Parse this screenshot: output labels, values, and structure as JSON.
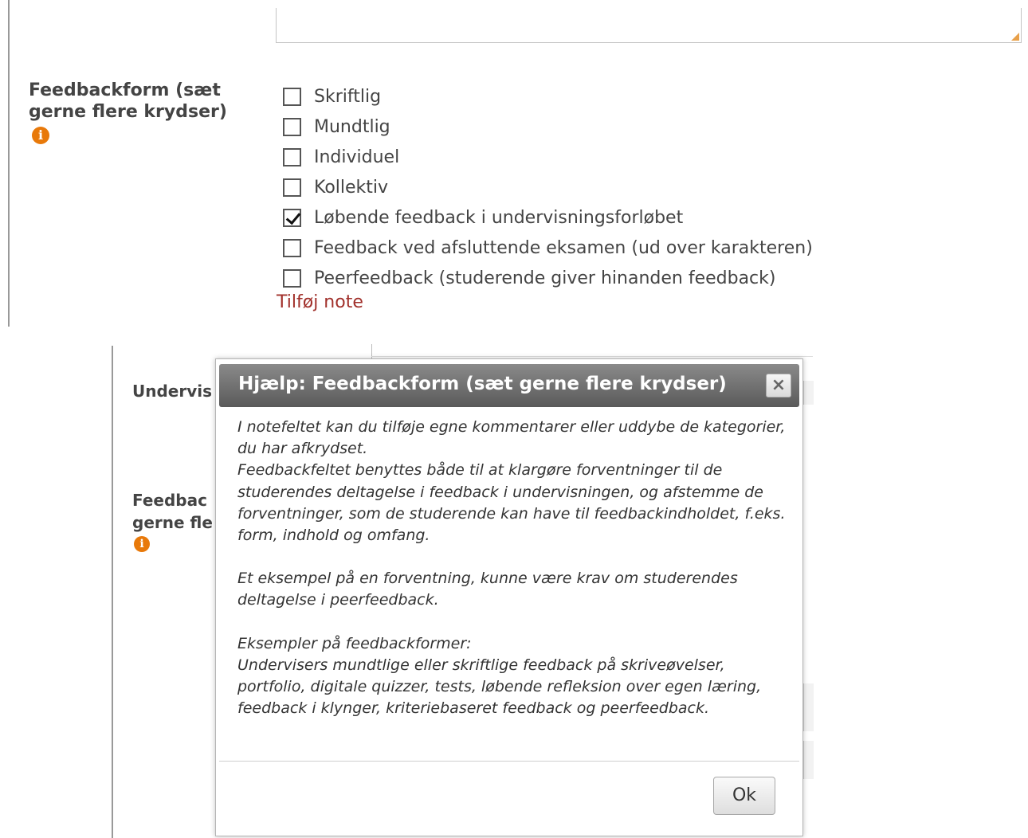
{
  "form": {
    "field_label": "Feedbackform (sæt gerne flere krydser)",
    "info_glyph": "i",
    "options": [
      {
        "label": "Skriftlig",
        "checked": false
      },
      {
        "label": "Mundtlig",
        "checked": false
      },
      {
        "label": "Individuel",
        "checked": false
      },
      {
        "label": "Kollektiv",
        "checked": false
      },
      {
        "label": "Løbende feedback i undervisningsforløbet",
        "checked": true
      },
      {
        "label": "Feedback ved afsluttende eksamen (ud over karakteren)",
        "checked": false
      },
      {
        "label": "Peerfeedback (studerende giver hinanden feedback)",
        "checked": false
      }
    ],
    "add_note_link": "Tilføj note"
  },
  "background": {
    "label_1": "Undervis",
    "label_2_line1": "Feedbac",
    "label_2_line2": "gerne fle"
  },
  "dialog": {
    "title": "Hjælp: Feedbackform (sæt gerne flere krydser)",
    "close_glyph": "×",
    "paragraphs": [
      "I notefeltet kan du tilføje egne kommentarer eller uddybe de kategorier, du har afkrydset.",
      "Feedbackfeltet benyttes både til at klargøre forventninger til de studerendes deltagelse i feedback i undervisningen, og afstemme de forventninger, som de studerende kan have til feedbackindholdet, f.eks. form, indhold og omfang.",
      "",
      "Et eksempel på en forventning, kunne være krav om studerendes deltagelse i peerfeedback.",
      "",
      "Eksempler på feedbackformer:",
      "Undervisers mundtlige eller skriftlige feedback på skriveøvelser, portfolio, digitale quizzer, tests, løbende refleksion over egen læring, feedback i klynger, kriteriebaseret feedback og peerfeedback."
    ],
    "ok_label": "Ok"
  },
  "colors": {
    "info_icon": "#e8790a",
    "link": "#a1302b",
    "dialog_header": "#6e6e6e"
  }
}
